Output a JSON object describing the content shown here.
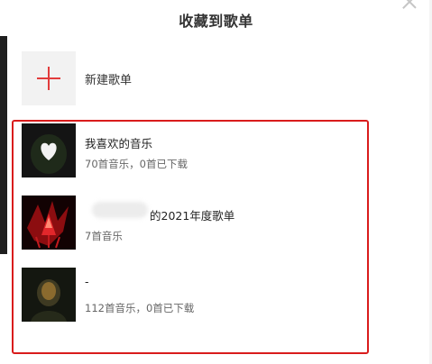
{
  "dialog": {
    "title": "收藏到歌单"
  },
  "create": {
    "label": "新建歌单"
  },
  "playlists": [
    {
      "name": "我喜欢的音乐",
      "meta": "70首音乐，0首已下载",
      "cover": "heart-cover"
    },
    {
      "name": "的2021年度歌单",
      "meta": "7首音乐",
      "cover": "red-stage-cover"
    },
    {
      "name": "-",
      "meta": "112首音乐，0首已下载",
      "cover": "portrait-cover"
    }
  ],
  "colors": {
    "accent": "#d91c1c",
    "plus": "#e23c3c"
  }
}
